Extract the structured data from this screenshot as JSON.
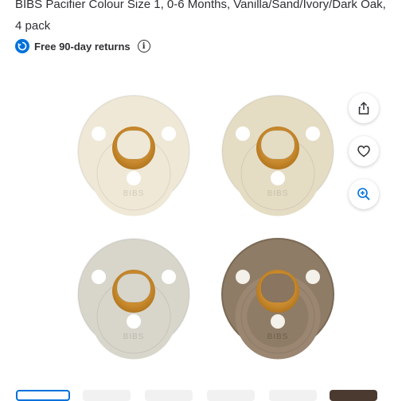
{
  "product": {
    "title": "BIBS Pacifier Colour Size 1, 0-6 Months, Vanilla/Sand/Ivory/Dark Oak, 4 pack",
    "returns_label": "Free 90-day returns",
    "images": [
      {
        "color": "Vanilla",
        "fill": "#efe8d6",
        "mark": "BIBS"
      },
      {
        "color": "Sand",
        "fill": "#e5dcc4",
        "mark": "BIBS"
      },
      {
        "color": "Ivory",
        "fill": "#d8d6cb",
        "mark": "BIBS"
      },
      {
        "color": "Dark Oak",
        "fill": "#8f7c66",
        "mark": "BIBS"
      }
    ]
  },
  "actions": {
    "share_icon": "share-icon",
    "favorite_icon": "heart-icon",
    "zoom_icon": "zoom-in-icon"
  },
  "colors": {
    "accent": "#0071dc",
    "text": "#2e2f32",
    "nipple": "#c98a2e"
  },
  "thumbnails": {
    "count": 6,
    "selected_index": 0
  }
}
